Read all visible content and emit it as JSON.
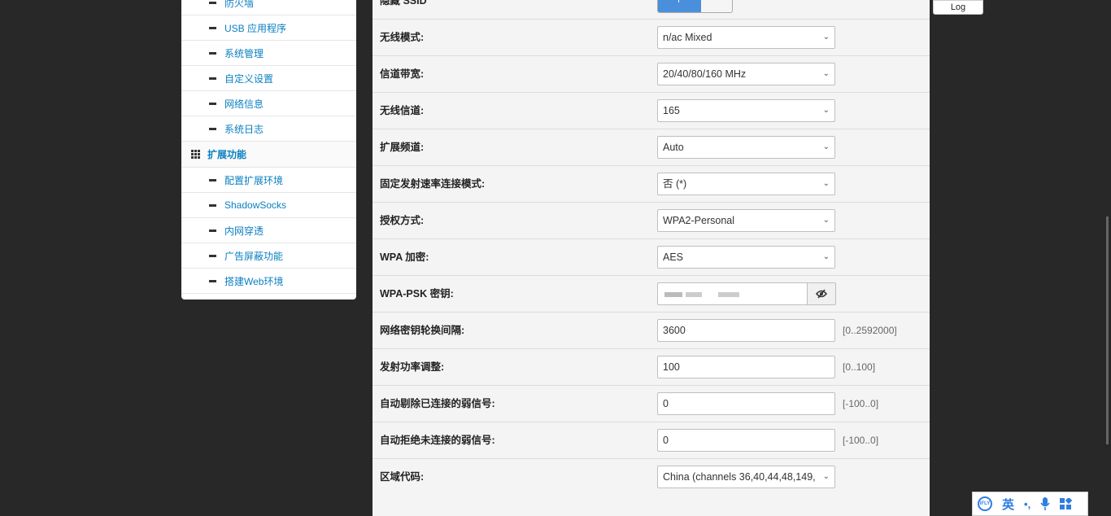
{
  "sidebar": {
    "items_top": [
      {
        "label": "防火墙"
      },
      {
        "label": "USB 应用程序"
      },
      {
        "label": "系统管理"
      },
      {
        "label": "自定义设置"
      },
      {
        "label": "网络信息"
      },
      {
        "label": "系统日志"
      }
    ],
    "group": {
      "label": "扩展功能"
    },
    "items_ext": [
      {
        "label": "配置扩展环境"
      },
      {
        "label": "ShadowSocks"
      },
      {
        "label": "内网穿透"
      },
      {
        "label": "广告屏蔽功能"
      },
      {
        "label": "搭建Web环境"
      }
    ]
  },
  "header": {
    "log_label": "Log"
  },
  "settings": {
    "hide_ssid": {
      "label": "隐藏 SSID"
    },
    "wireless_mode": {
      "label": "无线模式:",
      "value": "n/ac Mixed"
    },
    "bandwidth": {
      "label": "信道带宽:",
      "value": "20/40/80/160 MHz"
    },
    "channel": {
      "label": "无线信道:",
      "value": "165"
    },
    "ext_channel": {
      "label": "扩展频道:",
      "value": "Auto"
    },
    "fixed_rate": {
      "label": "固定发射速率连接模式:",
      "value": "否 (*)"
    },
    "auth_mode": {
      "label": "授权方式:",
      "value": "WPA2-Personal"
    },
    "wpa_encrypt": {
      "label": "WPA 加密:",
      "value": "AES"
    },
    "wpa_psk": {
      "label": "WPA-PSK 密钥:"
    },
    "rekey": {
      "label": "网络密钥轮换间隔:",
      "value": "3600",
      "hint": "[0..2592000]"
    },
    "tx_power": {
      "label": "发射功率调整:",
      "value": "100",
      "hint": "[0..100]"
    },
    "kick_weak": {
      "label": "自动剔除已连接的弱信号:",
      "value": "0",
      "hint": "[-100..0]"
    },
    "reject_weak": {
      "label": "自动拒绝未连接的弱信号:",
      "value": "0",
      "hint": "[-100..0]"
    },
    "region": {
      "label": "区域代码:",
      "value": "China (channels 36,40,44,48,149,"
    }
  },
  "ime": {
    "lang": "英",
    "punct": "•,"
  },
  "icons": {
    "expand": "chevron-down-icon",
    "eye": "eye-slash-icon",
    "grid": "grid-icon"
  }
}
